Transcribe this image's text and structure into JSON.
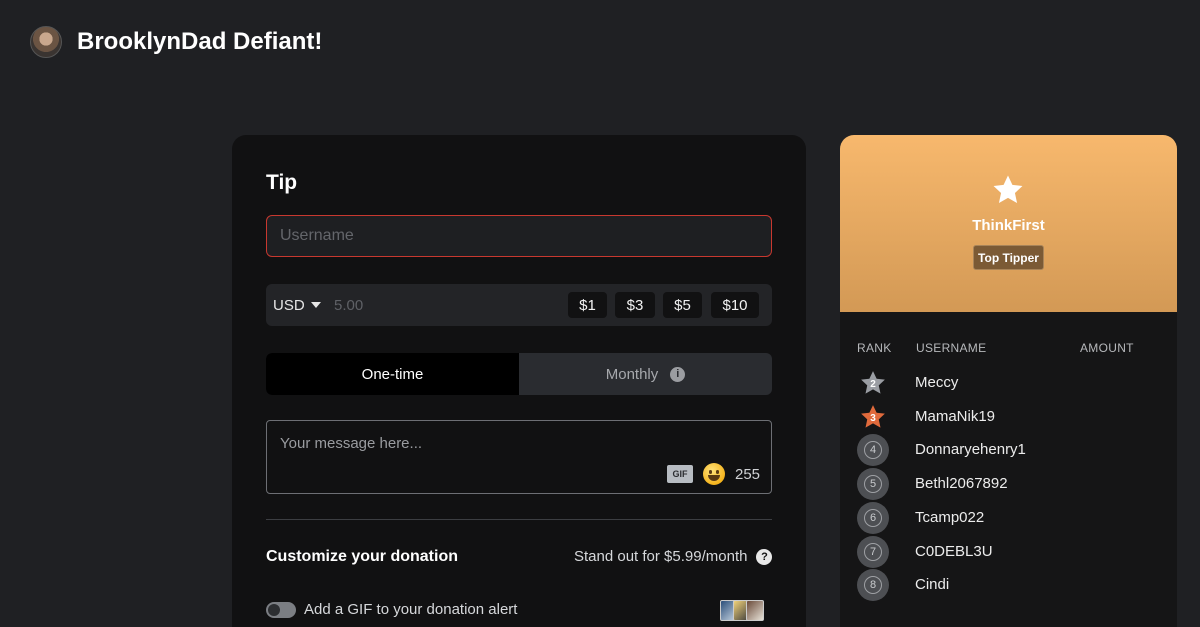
{
  "header": {
    "channel_name": "BrooklynDad Defiant!"
  },
  "tip_form": {
    "title": "Tip",
    "username_placeholder": "Username",
    "currency": "USD",
    "amount_placeholder": "5.00",
    "presets": [
      "$1",
      "$3",
      "$5",
      "$10"
    ],
    "frequency": {
      "one_time": "One-time",
      "monthly": "Monthly",
      "selected": "one_time"
    },
    "message_placeholder": "Your message here...",
    "gif_label": "GIF",
    "char_count": "255",
    "customize_title": "Customize your donation",
    "standout_text": "Stand out for $5.99/month",
    "gif_toggle_label": "Add a GIF to your donation alert",
    "gif_toggle_on": false
  },
  "leaderboard": {
    "top_tipper": {
      "name": "ThinkFirst",
      "badge": "Top Tipper"
    },
    "columns": {
      "rank": "RANK",
      "username": "USERNAME",
      "amount": "AMOUNT"
    },
    "rows": [
      {
        "rank": "2",
        "username": "Meccy",
        "medal": "silver"
      },
      {
        "rank": "3",
        "username": "MamaNik19",
        "medal": "bronze"
      },
      {
        "rank": "4",
        "username": "Donnaryehenry1"
      },
      {
        "rank": "5",
        "username": "Bethl2067892"
      },
      {
        "rank": "6",
        "username": "Tcamp022"
      },
      {
        "rank": "7",
        "username": "C0DEBL3U"
      },
      {
        "rank": "8",
        "username": "Cindi"
      }
    ]
  },
  "colors": {
    "background": "#1f2023",
    "card": "#111112",
    "error_border": "#c8382f",
    "gold_gradient_top": "#f7b86d",
    "gold_gradient_bottom": "#d39955",
    "silver_medal": "#9a9da3",
    "bronze_medal": "#e06a3c"
  },
  "icons": {
    "currency_caret": "chevron-down-icon",
    "monthly_info": "info-icon",
    "emoji": "emoji-icon",
    "help": "help-icon",
    "top_star": "star-icon"
  }
}
